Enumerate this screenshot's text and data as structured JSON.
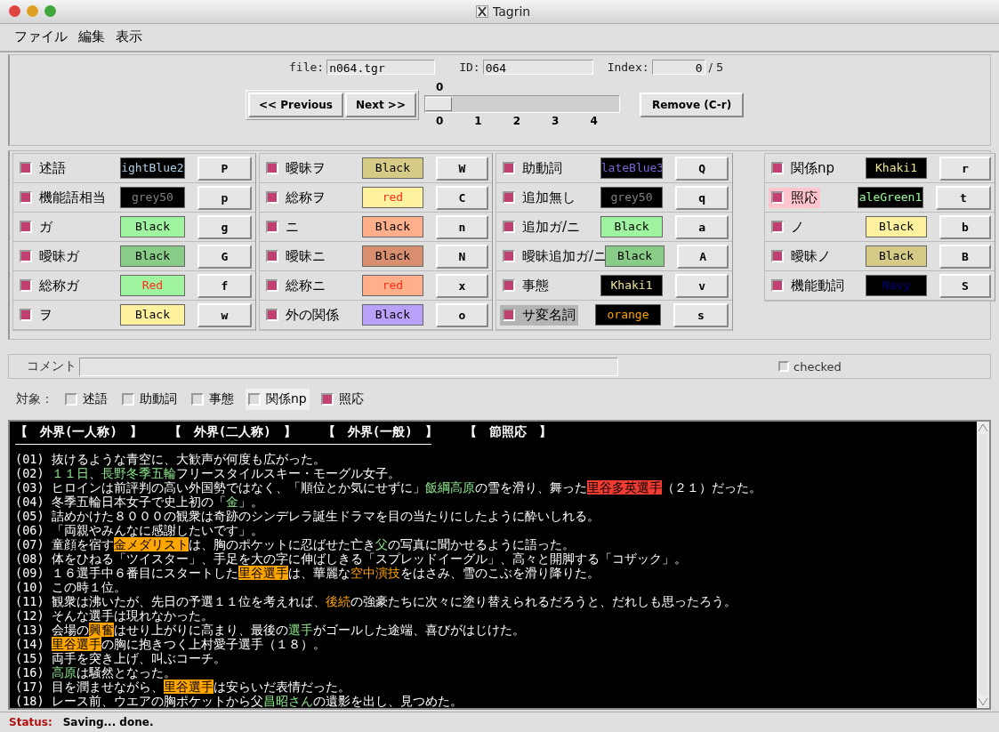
{
  "window": {
    "title": "Tagrin"
  },
  "menu": [
    "ファイル",
    "編集",
    "表示"
  ],
  "file_bar": {
    "file_label": "file:",
    "file": "n064.tgr",
    "id_label": "ID:",
    "id": "064",
    "index_label": "Index:",
    "index": "0",
    "total": "/ 5"
  },
  "nav": {
    "previous": "<< Previous",
    "next": "Next >>",
    "remove": "Remove (C-r)"
  },
  "slider": {
    "value": "0",
    "level": 0,
    "ticks": [
      "0",
      "1",
      "2",
      "3",
      "4"
    ]
  },
  "tag_columns": [
    {
      "tags": [
        {
          "label": "述語",
          "checked": true,
          "selected": false,
          "hovered": false,
          "swatch": "ightBlue2",
          "color": "#000000",
          "ink": {
            "color": "#b0d0ea"
          },
          "key": "P"
        },
        {
          "label": "機能語相当",
          "checked": true,
          "selected": false,
          "hovered": false,
          "swatch": "grey50",
          "color": "#000000",
          "ink": {
            "color": "#808080"
          },
          "key": "p"
        },
        {
          "label": "ガ",
          "checked": true,
          "selected": false,
          "hovered": false,
          "swatch": "Black",
          "color": "#a0f4a0",
          "ink": {
            "color": "#000000"
          },
          "key": "g"
        },
        {
          "label": "曖昧ガ",
          "checked": true,
          "selected": false,
          "hovered": false,
          "swatch": "Black",
          "color": "#88cc88",
          "ink": {
            "color": "#000000"
          },
          "key": "G"
        },
        {
          "label": "総称ガ",
          "checked": true,
          "selected": false,
          "hovered": false,
          "swatch": "Red",
          "color": "#a0f4a0",
          "ink": {
            "color": "#ff2a1a"
          },
          "key": "f"
        },
        {
          "label": "ヲ",
          "checked": true,
          "selected": false,
          "hovered": false,
          "swatch": "Black",
          "color": "#fff29e",
          "ink": {
            "color": "#000000"
          },
          "key": "w"
        }
      ]
    },
    {
      "tags": [
        {
          "label": "曖昧ヲ",
          "checked": true,
          "selected": false,
          "hovered": false,
          "swatch": "Black",
          "color": "#d6cb86",
          "ink": {
            "color": "#000000"
          },
          "key": "W"
        },
        {
          "label": "総称ヲ",
          "checked": true,
          "selected": false,
          "hovered": false,
          "swatch": "red",
          "color": "#fff29e",
          "ink": {
            "color": "#ff2a1a"
          },
          "key": "C"
        },
        {
          "label": "ニ",
          "checked": true,
          "selected": false,
          "hovered": false,
          "swatch": "Black",
          "color": "#ffb08a",
          "ink": {
            "color": "#000000"
          },
          "key": "n"
        },
        {
          "label": "曖昧ニ",
          "checked": true,
          "selected": false,
          "hovered": false,
          "swatch": "Black",
          "color": "#d88f70",
          "ink": {
            "color": "#000000"
          },
          "key": "N"
        },
        {
          "label": "総称ニ",
          "checked": true,
          "selected": false,
          "hovered": false,
          "swatch": "red",
          "color": "#ffb08a",
          "ink": {
            "color": "#ff2a1a"
          },
          "key": "x"
        },
        {
          "label": "外の関係",
          "checked": true,
          "selected": false,
          "hovered": false,
          "swatch": "Black",
          "color": "#b9a0f8",
          "ink": {
            "color": "#000000"
          },
          "key": "o"
        }
      ]
    },
    {
      "tags": [
        {
          "label": "助動詞",
          "checked": true,
          "selected": false,
          "hovered": false,
          "swatch": "lateBlue3",
          "color": "#000000",
          "ink": {
            "color": "#7a68d8"
          },
          "key": "Q"
        },
        {
          "label": "追加無し",
          "checked": true,
          "selected": false,
          "hovered": false,
          "swatch": "grey50",
          "color": "#000000",
          "ink": {
            "color": "#808080"
          },
          "key": "q"
        },
        {
          "label": "追加ガ/ニ",
          "checked": true,
          "selected": false,
          "hovered": false,
          "swatch": "Black",
          "color": "#a0f4a0",
          "ink": {
            "color": "#000000"
          },
          "key": "a"
        },
        {
          "label": "曖昧追加ガ/ニ",
          "checked": true,
          "selected": false,
          "hovered": false,
          "swatch": "Black",
          "color": "#88cc88",
          "ink": {
            "color": "#000000"
          },
          "key": "A"
        },
        {
          "label": "事態",
          "checked": true,
          "selected": false,
          "hovered": false,
          "swatch": "Khaki1",
          "color": "#000000",
          "ink": {
            "color": "#f0e68c"
          },
          "key": "v"
        },
        {
          "label": "サ変名詞",
          "checked": true,
          "selected": false,
          "hovered": true,
          "swatch": "orange",
          "color": "#000000",
          "ink": {
            "color": "#ffa500"
          },
          "key": "s"
        }
      ]
    },
    {
      "tags": [
        {
          "label": "関係np",
          "checked": true,
          "selected": false,
          "hovered": false,
          "swatch": "Khaki1",
          "color": "#000000",
          "ink": {
            "color": "#f0e68c"
          },
          "key": "r"
        },
        {
          "label": "照応",
          "checked": true,
          "selected": true,
          "hovered": false,
          "swatch": "aleGreen1",
          "color": "#000000",
          "ink": {
            "color": "#9aff9a"
          },
          "key": "t"
        },
        {
          "label": "ノ",
          "checked": true,
          "selected": false,
          "hovered": false,
          "swatch": "Black",
          "color": "#fff29e",
          "ink": {
            "color": "#000000"
          },
          "key": "b"
        },
        {
          "label": "曖昧ノ",
          "checked": true,
          "selected": false,
          "hovered": false,
          "swatch": "Black",
          "color": "#d6cb86",
          "ink": {
            "color": "#000000"
          },
          "key": "B"
        },
        {
          "label": "機能動詞",
          "checked": true,
          "selected": false,
          "hovered": false,
          "swatch": "Navy",
          "color": "#000000",
          "ink": {
            "color": "#000080"
          },
          "key": "S"
        }
      ]
    }
  ],
  "comment": {
    "label": "コメント",
    "checked_label": "checked",
    "checked": false
  },
  "targets": {
    "label": "対象：",
    "items": [
      {
        "label": "述語",
        "checked": false,
        "hovered": false
      },
      {
        "label": "助動詞",
        "checked": false,
        "hovered": false
      },
      {
        "label": "事態",
        "checked": false,
        "hovered": false
      },
      {
        "label": "関係np",
        "checked": false,
        "hovered": true
      },
      {
        "label": "照応",
        "checked": true,
        "hovered": false
      }
    ]
  },
  "text_view": {
    "headers": [
      "【　外界(一人称)　】",
      "【　外界(二人称)　】",
      "【　外界(一般)　】",
      "【　節照応　】"
    ],
    "lines": [
      {
        "num": "(01)",
        "segments": [
          {
            "kind": "plain",
            "text": "抜けるような青空に、大歓声が何度も広がった。"
          }
        ]
      },
      {
        "num": "(02)",
        "segments": [
          {
            "kind": "green",
            "text": "１１日"
          },
          {
            "kind": "plain",
            "text": "、"
          },
          {
            "kind": "green",
            "text": "長野冬季五輪"
          },
          {
            "kind": "plain",
            "text": "フリースタイルスキー・モーグル女子。"
          }
        ]
      },
      {
        "num": "(03)",
        "segments": [
          {
            "kind": "plain",
            "text": "ヒロインは前評判の高い外国勢ではなく、「順位とか気にせずに」"
          },
          {
            "kind": "green",
            "text": "飯綱高原"
          },
          {
            "kind": "plain",
            "text": "の雪を滑り、舞った"
          },
          {
            "kind": "red",
            "text": "里谷多英選手"
          },
          {
            "kind": "plain",
            "text": "（２１）だった。"
          }
        ]
      },
      {
        "num": "(04)",
        "segments": [
          {
            "kind": "plain",
            "text": "冬季五輪日本女子で史上初の「"
          },
          {
            "kind": "green",
            "text": "金"
          },
          {
            "kind": "plain",
            "text": "」。"
          }
        ]
      },
      {
        "num": "(05)",
        "segments": [
          {
            "kind": "plain",
            "text": "詰めかけた８０００の観衆は奇跡のシンデレラ誕生ドラマを目の当たりにしたように酔いしれる。"
          }
        ]
      },
      {
        "num": "(06)",
        "segments": [
          {
            "kind": "plain",
            "text": "「両親やみんなに感謝したいです」。"
          }
        ]
      },
      {
        "num": "(07)",
        "segments": [
          {
            "kind": "plain",
            "text": "童顔を宿す"
          },
          {
            "kind": "highlight",
            "text": "金メダリスト"
          },
          {
            "kind": "plain",
            "text": "は、胸のポケットに忍ばせた亡き"
          },
          {
            "kind": "green",
            "text": "父"
          },
          {
            "kind": "plain",
            "text": "の写真に聞かせるように語った。"
          }
        ]
      },
      {
        "num": "(08)",
        "segments": [
          {
            "kind": "plain",
            "text": "体をひねる「ツイスター」、手足を大の字に伸ばしきる「スプレッドイーグル」、高々と開脚する「コザック」。"
          }
        ]
      },
      {
        "num": "(09)",
        "segments": [
          {
            "kind": "plain",
            "text": "１６選手中６番目にスタートした"
          },
          {
            "kind": "highlight",
            "text": "里谷選手"
          },
          {
            "kind": "plain",
            "text": "は、華麗な"
          },
          {
            "kind": "orange",
            "text": "空中演技"
          },
          {
            "kind": "plain",
            "text": "をはさみ、雪のこぶを滑り降りた。"
          }
        ]
      },
      {
        "num": "(10)",
        "segments": [
          {
            "kind": "plain",
            "text": "この時１位。"
          }
        ]
      },
      {
        "num": "(11)",
        "segments": [
          {
            "kind": "plain",
            "text": "観衆は沸いたが、先日の予選１１位を考えれば、"
          },
          {
            "kind": "orange",
            "text": "後続"
          },
          {
            "kind": "plain",
            "text": "の強豪たちに次々に塗り替えられるだろうと、だれしも思ったろう。"
          }
        ]
      },
      {
        "num": "(12)",
        "segments": [
          {
            "kind": "plain",
            "text": "そんな選手は現れなかった。"
          }
        ]
      },
      {
        "num": "(13)",
        "segments": [
          {
            "kind": "plain",
            "text": "会場の"
          },
          {
            "kind": "highlight",
            "text": "興奮"
          },
          {
            "kind": "plain",
            "text": "はせり上がりに高まり、最後の"
          },
          {
            "kind": "green",
            "text": "選手"
          },
          {
            "kind": "plain",
            "text": "がゴールした途端、喜びがはじけた。"
          }
        ]
      },
      {
        "num": "(14)",
        "segments": [
          {
            "kind": "highlight",
            "text": "里谷選手"
          },
          {
            "kind": "plain",
            "text": "の胸に抱きつく上村愛子選手（１８）。"
          }
        ]
      },
      {
        "num": "(15)",
        "segments": [
          {
            "kind": "plain",
            "text": "両手を突き上げ、叫ぶコーチ。"
          }
        ]
      },
      {
        "num": "(16)",
        "segments": [
          {
            "kind": "green",
            "text": "高原"
          },
          {
            "kind": "plain",
            "text": "は騒然となった。"
          }
        ]
      },
      {
        "num": "(17)",
        "segments": [
          {
            "kind": "plain",
            "text": "目を潤ませながら、"
          },
          {
            "kind": "highlight",
            "text": "里谷選手"
          },
          {
            "kind": "plain",
            "text": "は安らいだ表情だった。"
          }
        ]
      },
      {
        "num": "(18)",
        "segments": [
          {
            "kind": "plain",
            "text": "レース前、ウエアの胸ポケットから父"
          },
          {
            "kind": "green",
            "text": "昌昭さん"
          },
          {
            "kind": "plain",
            "text": "の遺影を出し、見つめた。"
          }
        ]
      }
    ]
  },
  "status": {
    "label": "Status:",
    "text": "Saving... done."
  }
}
